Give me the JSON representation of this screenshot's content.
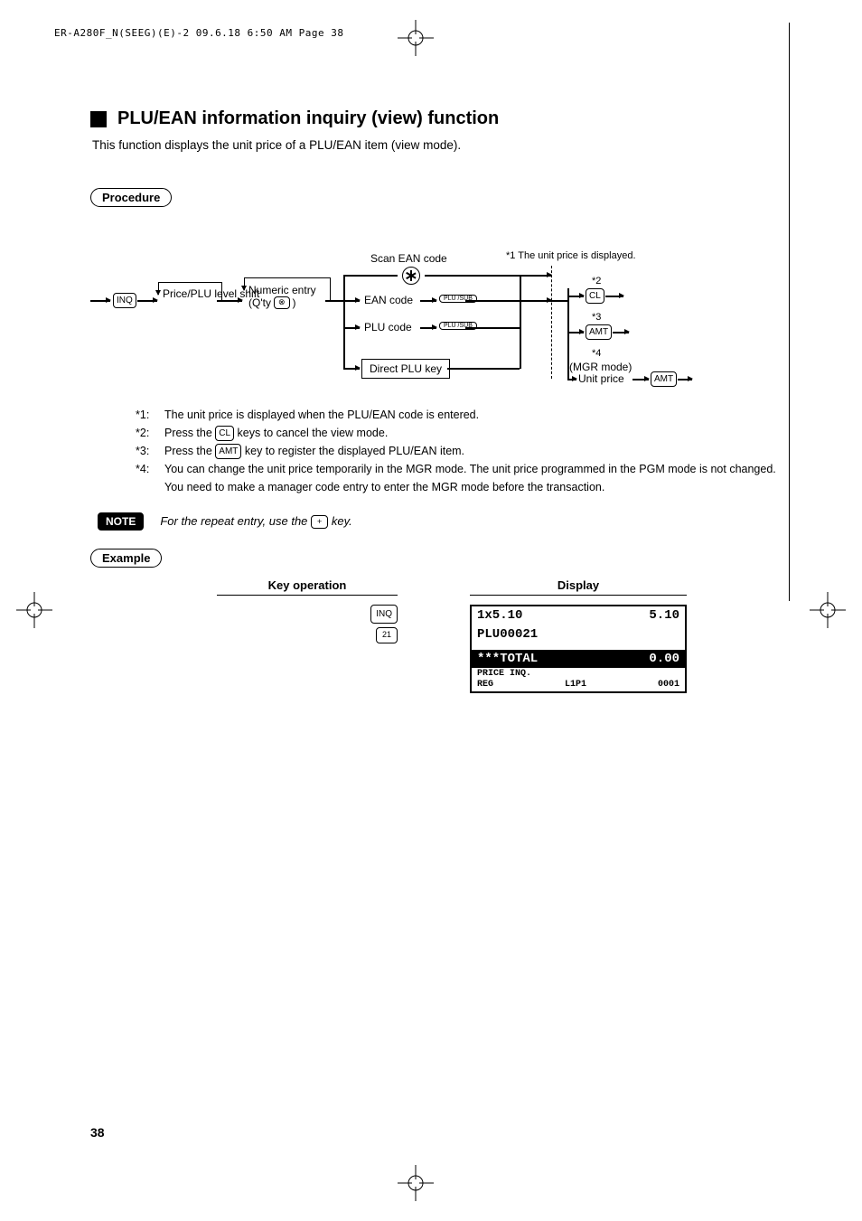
{
  "header": "ER-A280F_N(SEEG)(E)-2  09.6.18 6:50 AM  Page 38",
  "title": "PLU/EAN information inquiry (view) function",
  "intro": "This function displays the unit price of a PLU/EAN item (view mode).",
  "labels": {
    "procedure": "Procedure",
    "example": "Example",
    "note": "NOTE"
  },
  "diagram": {
    "inq": "INQ",
    "pricePLU": "Price/PLU level shift",
    "numericEntry": "Numeric entry",
    "qty": "(Q'ty",
    "qtyClose": ")",
    "scanEAN": "Scan EAN code",
    "eanCode": "EAN code",
    "pluCode": "PLU code",
    "pluSub": "PLU /SUB",
    "directPLU": "Direct PLU key",
    "note1": "The unit price is displayed.",
    "star1": "*1",
    "star2": "*2",
    "star3": "*3",
    "star4": "*4",
    "cl": "CL",
    "amt": "AMT",
    "mgrMode": "(MGR mode)",
    "unitPrice": "Unit price",
    "otimes": "⊗"
  },
  "notes": [
    {
      "lbl": "*1:",
      "text": "The unit price is displayed when the PLU/EAN code is entered."
    },
    {
      "lbl": "*2:",
      "text_pre": "Press the ",
      "key": "CL",
      "text_post": " keys to cancel the view mode."
    },
    {
      "lbl": "*3:",
      "text_pre": "Press the ",
      "key": "AMT",
      "text_post": " key to register the displayed PLU/EAN item."
    },
    {
      "lbl": "*4:",
      "text": "You can change the unit price temporarily in the MGR mode. The unit price programmed in the PGM mode is not changed. You need to make a manager code entry to enter the MGR mode before the transaction."
    }
  ],
  "noteLine": {
    "pre": "For the repeat entry, use the ",
    "key": "+",
    "post": " key."
  },
  "example": {
    "keyOpHead": "Key operation",
    "displayHead": "Display",
    "keys": [
      "INQ",
      "21"
    ],
    "lcd1": {
      "row1l": "1x5.10",
      "row1r": "5.10",
      "row2": "PLU00021"
    },
    "lcd2": {
      "r1l": "***TOTAL",
      "r1r": "0.00",
      "r2l": "PRICE INQ.",
      "r2r": "",
      "r3l": "REG",
      "r3m": "L1P1",
      "r3r": "0001"
    }
  },
  "pageNum": "38"
}
